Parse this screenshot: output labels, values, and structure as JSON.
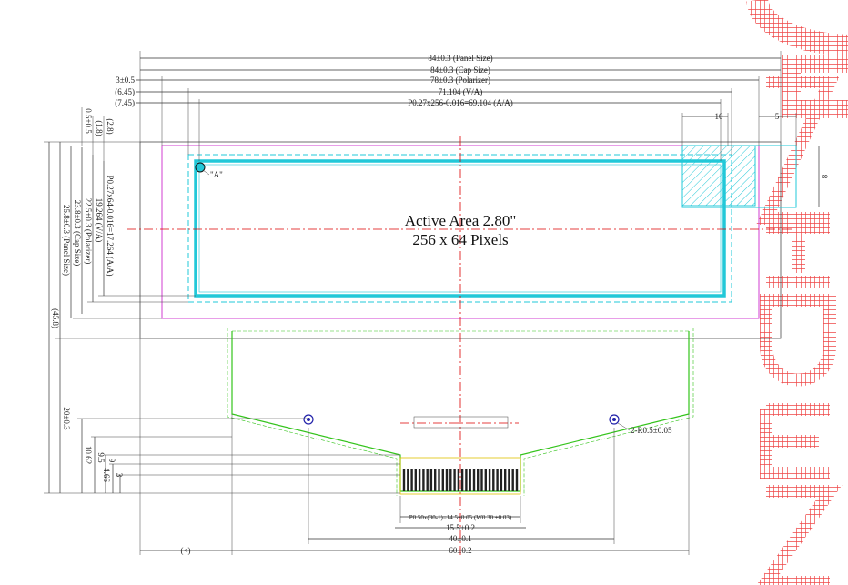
{
  "drawing": {
    "active_area_title": "Active Area 2.80\"",
    "active_area_pixels": "256 x 64 Pixels",
    "point_a_label": "\"A\"",
    "horizontal_dims": {
      "panel_size": "84±0.3 (Panel Size)",
      "cap_size": "84±0.3 (Cap Size)",
      "polarizer": "78±0.3 (Polarizer)",
      "va": "71.104 (V/A)",
      "aa": "P0.27x256-0.016=69.104 (A/A)",
      "left_3": "3±0.5",
      "left_645": "(6.45)",
      "left_745": "(7.45)",
      "right_10": "10",
      "right_5": "5"
    },
    "vertical_dims": {
      "d05": "0.5±0.5",
      "d28": "(2.8)",
      "d18": "(1.8)",
      "aa_height": "P0.27x64-0.016=17.264 (A/A)",
      "va_height": "19.264 (V/A)",
      "polarizer_height": "22.5±0.3 (Polarizer)",
      "cap_height": "23.8±0.3 (Cap Size)",
      "panel_height": "25.8±0.3 (Panel Size)",
      "total_height": "(45.8)",
      "fpc_height": "20±0.3",
      "d1062": "10.62",
      "d95": "9.5",
      "d9": "9",
      "d466": "4.66",
      "d3": "3",
      "right_8": "8"
    },
    "fpc_dims": {
      "pitch": "P0.50x(30-1)=14.5±0.05 (W0.30 ±0.03)",
      "w155": "15.5±0.2",
      "w40": "40±0.1",
      "w60": "60±0.2",
      "paren": "(<)",
      "hole": "2-R0.5±0.05"
    },
    "watermark_text": "CONFIDENTIAL",
    "colors": {
      "cyan": "#22c8d8",
      "magenta": "#d23cd2",
      "green": "#34c41c",
      "watermark": "#e22",
      "centerline": "#d00"
    }
  }
}
